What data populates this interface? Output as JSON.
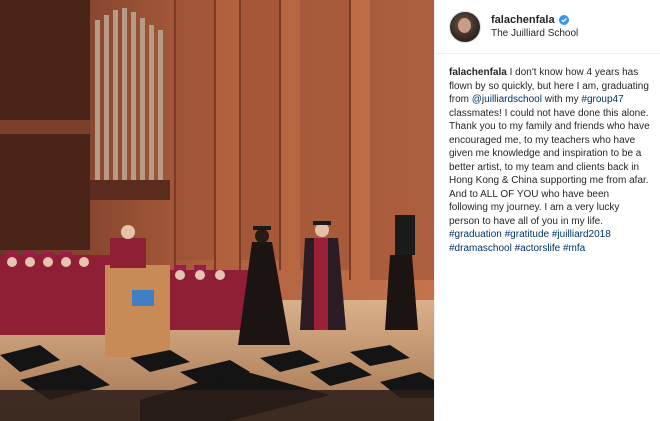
{
  "post": {
    "username": "falachenfala",
    "location": "The Juilliard School",
    "caption": {
      "username": "falachenfala",
      "text_1": " I don't know how 4 years has flown by so quickly, but here I am, graduating from ",
      "mention_juilliard": "@juilliardschool",
      "text_2": " with my ",
      "tag_group47": "#group47",
      "text_3": " classmates! I could not have done this alone. Thank you to my family and friends who have encouraged me, to my teachers who have given me knowledge and inspiration to be a better artist, to my team and clients back in Hong Kong & China supporting me from afar. And to ALL OF YOU who have been following my journey. I am a very lucky person to have all of you in my life. ",
      "tag_graduation": "#graduation",
      "tag_gratitude": "#gratitude",
      "tag_juilliard2018": "#juilliard2018",
      "tag_dramaschool": "#dramaschool",
      "tag_actorslife": "#actorslife",
      "tag_mfa": "#mfa"
    }
  },
  "colors": {
    "link": "#003569",
    "verified": "#3897f0",
    "text": "#262626"
  },
  "icons": {
    "verified": "verified-badge-icon"
  }
}
